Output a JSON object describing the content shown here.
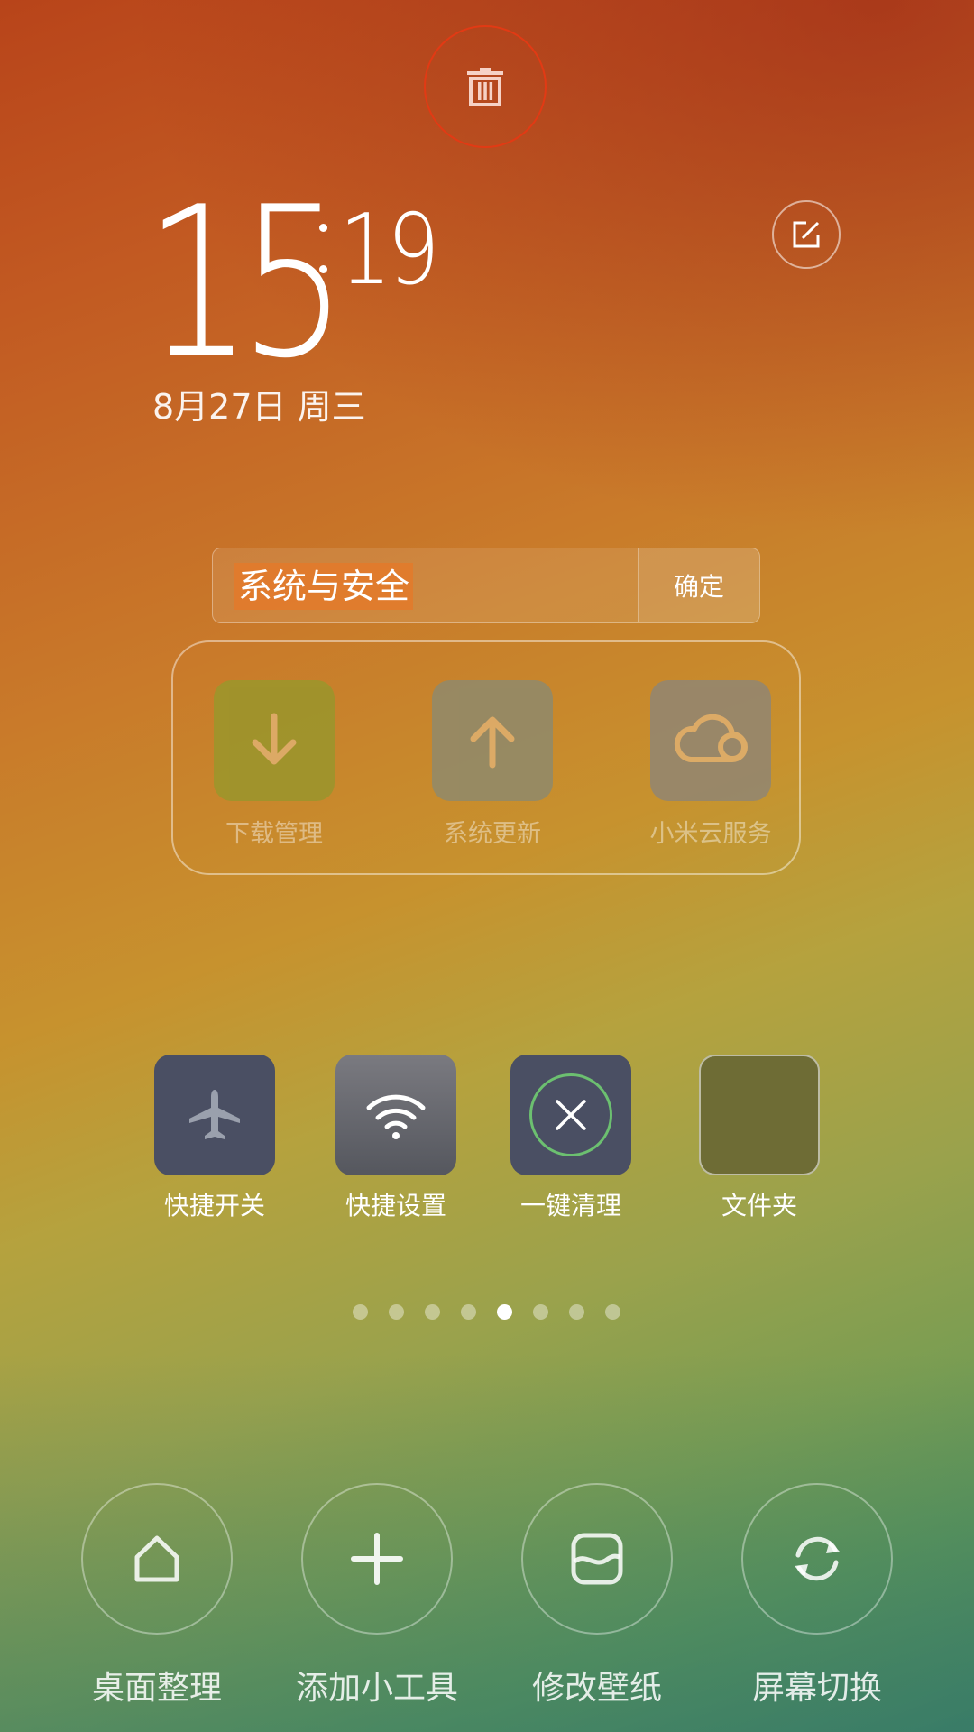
{
  "clock": {
    "hour": "15",
    "minute": "19",
    "date": "8月27日 周三"
  },
  "folder": {
    "name": "系统与安全",
    "confirm_label": "确定",
    "apps": [
      {
        "label": "下载管理",
        "icon": "download-icon",
        "color": "#9a9a2a"
      },
      {
        "label": "系统更新",
        "icon": "upload-icon",
        "color": "#8a8a70"
      },
      {
        "label": "小米云服务",
        "icon": "cloud-icon",
        "color": "#8e8570"
      }
    ]
  },
  "desktop": {
    "apps": [
      {
        "label": "快捷开关",
        "icon": "airplane-icon"
      },
      {
        "label": "快捷设置",
        "icon": "wifi-icon"
      },
      {
        "label": "一键清理",
        "icon": "close-icon"
      },
      {
        "label": "文件夹",
        "icon": "folder-icon"
      }
    ]
  },
  "pager": {
    "count": 8,
    "active_index": 4
  },
  "actions": [
    {
      "label": "桌面整理",
      "icon": "home-icon"
    },
    {
      "label": "添加小工具",
      "icon": "plus-icon"
    },
    {
      "label": "修改壁纸",
      "icon": "wallpaper-icon"
    },
    {
      "label": "屏幕切换",
      "icon": "refresh-icon"
    }
  ],
  "colors": {
    "trash_ring": "#e23a14",
    "clean_ring": "#6cc070",
    "icon_dark": "#4a4f63"
  }
}
